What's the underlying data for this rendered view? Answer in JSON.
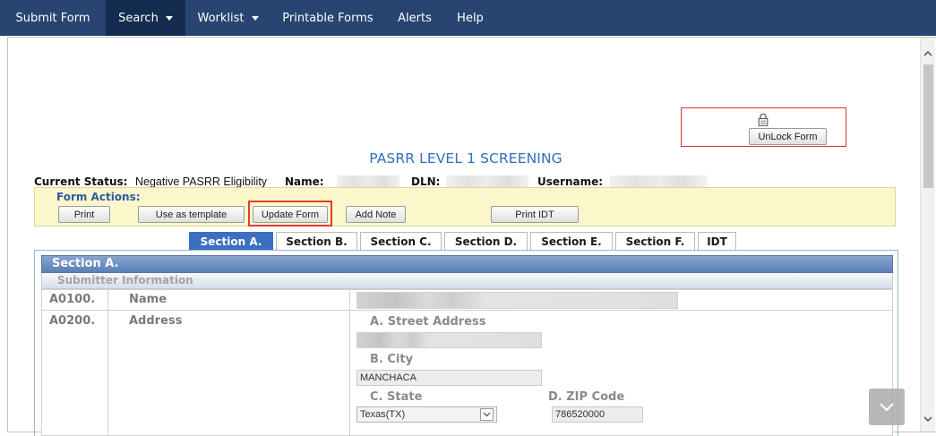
{
  "nav": {
    "items": [
      {
        "label": "Submit Form",
        "dropdown": false,
        "active": false
      },
      {
        "label": "Search",
        "dropdown": true,
        "active": true
      },
      {
        "label": "Worklist",
        "dropdown": true,
        "active": false
      },
      {
        "label": "Printable Forms",
        "dropdown": false,
        "active": false
      },
      {
        "label": "Alerts",
        "dropdown": false,
        "active": false
      },
      {
        "label": "Help",
        "dropdown": false,
        "active": false
      }
    ]
  },
  "lock_panel": {
    "button_label": "UnLock Form"
  },
  "page_title": "PASRR LEVEL 1 SCREENING",
  "status_bar": {
    "status_label": "Current Status:",
    "status_value": "Negative PASRR Eligibility",
    "name_label": "Name:",
    "dln_label": "DLN:",
    "username_label": "Username:"
  },
  "form_actions": {
    "label": "Form Actions:",
    "print": "Print",
    "use_as_template": "Use as template",
    "update_form": "Update Form",
    "add_note": "Add Note",
    "print_idt": "Print IDT"
  },
  "tabs": [
    "Section A.",
    "Section B.",
    "Section C.",
    "Section D.",
    "Section E.",
    "Section F.",
    "IDT"
  ],
  "active_tab_index": 0,
  "section": {
    "title": "Section A.",
    "subheader": "Submitter Information",
    "rows": [
      {
        "code": "A0100.",
        "label": "Name"
      },
      {
        "code": "A0200.",
        "label": "Address"
      }
    ],
    "address": {
      "street_label": "A. Street Address",
      "city_label": "B. City",
      "city_value": "MANCHACA",
      "state_label": "C. State",
      "state_value": "Texas(TX)",
      "zip_label": "D. ZIP Code",
      "zip_value": "786520000"
    }
  },
  "icons": {
    "nav_dropdown": "caret-down-icon",
    "lock": "lock-icon",
    "select_arrow": "chevron-down-icon",
    "scroll_up": "chevron-up-icon",
    "scroll_down": "chevron-down-icon",
    "floating_button": "chevron-down-icon"
  },
  "colors": {
    "nav_bg": "#284470",
    "nav_active_bg": "#132c50",
    "title": "#2f6fbd",
    "form_actions_bg": "#fbf7cb",
    "highlight_border": "#dd3c33",
    "active_tab_bg": "#3b6fc0",
    "section_header": "#5a80b8"
  }
}
